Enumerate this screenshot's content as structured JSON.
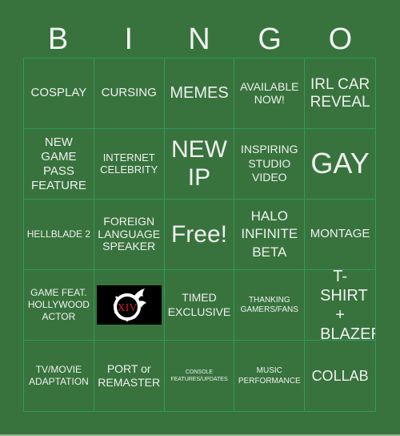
{
  "header": {
    "letters": [
      "B",
      "I",
      "N",
      "G",
      "O"
    ]
  },
  "cells": [
    {
      "text": "COSPLAY"
    },
    {
      "text": "CURSING"
    },
    {
      "text": "MEMES"
    },
    {
      "text": "AVAILABLE NOW!"
    },
    {
      "text": "IRL CAR REVEAL"
    },
    {
      "text": "NEW GAME PASS FEATURE"
    },
    {
      "text": "INTERNET CELEBRITY"
    },
    {
      "text": "NEW IP"
    },
    {
      "text": "INSPIRING STUDIO VIDEO"
    },
    {
      "text": "GAY"
    },
    {
      "text": "HELLBLADE 2"
    },
    {
      "text": "FOREIGN LANGUAGE SPEAKER"
    },
    {
      "text": "Free!"
    },
    {
      "text": "HALO INFINITE BETA"
    },
    {
      "text": "MONTAGE"
    },
    {
      "text": "GAME FEAT. HOLLYWOOD ACTOR"
    },
    {
      "text": "",
      "image": "final-fantasy-xiv-logo",
      "image_label": "XIV"
    },
    {
      "text": "TIMED EXCLUSIVE"
    },
    {
      "text": "THANKING GAMERS/FANS"
    },
    {
      "text": "T-SHIRT + BLAZER"
    },
    {
      "text": "TV/MOVIE ADAPTATION"
    },
    {
      "text": "PORT or REMASTER"
    },
    {
      "text": "CONSOLE FEATURES/UPDATES"
    },
    {
      "text": "MUSIC PERFORMANCE"
    },
    {
      "text": "COLLAB"
    }
  ],
  "colors": {
    "background": "#38733d",
    "grid_line": "#2e9a5f",
    "text": "#f0f0f0",
    "logo_red": "#d0202a"
  }
}
